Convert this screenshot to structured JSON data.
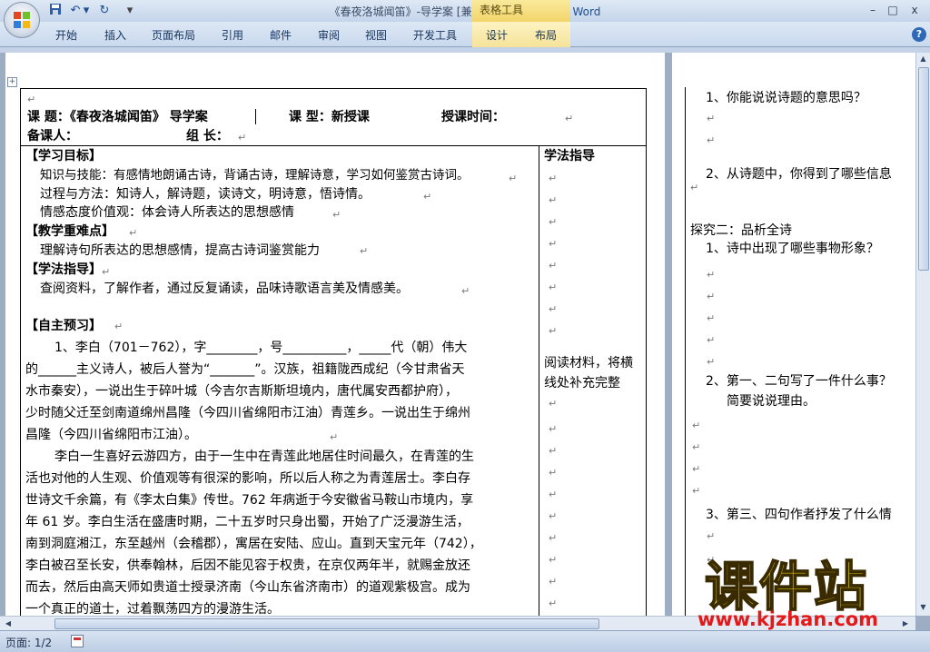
{
  "window": {
    "title_doc": "《春夜洛城闻笛》-导学案 [兼容模式] - ",
    "title_app": "Microsoft Word",
    "context_tool": "表格工具",
    "minimize": "–",
    "maximize": "□",
    "close": "x"
  },
  "quick_access": {
    "save": "save-icon",
    "undo": "↶",
    "undo_dropdown": "▾",
    "redo": "↻",
    "customize": "▾"
  },
  "ribbon": {
    "tabs": [
      "开始",
      "插入",
      "页面布局",
      "引用",
      "邮件",
      "审阅",
      "视图",
      "开发工具",
      "设计",
      "布局"
    ],
    "help": "?"
  },
  "document": {
    "para_mark": "↵",
    "header": {
      "course_title": "课  题：《春夜洛城闻笛》 导学案",
      "course_type": "课  型：新授课",
      "teach_time": "授课时间：",
      "prep_person": "备课人：",
      "group_leader": "组  长："
    },
    "main_lines": [
      {
        "text": "【学习目标】",
        "bold": true
      },
      {
        "text": "知识与技能：有感情地朗诵古诗，背诵古诗，理解诗意，学习如何鉴赏古诗词。",
        "bold": false
      },
      {
        "text": "过程与方法：知诗人，解诗题，读诗文，明诗意，悟诗情。",
        "bold": false
      },
      {
        "text": "情感态度价值观：体会诗人所表达的思想感情",
        "bold": false
      },
      {
        "text": "【教学重难点】",
        "bold": true
      },
      {
        "text": "理解诗句所表达的思想感情，提高古诗词鉴赏能力",
        "bold": false
      },
      {
        "text": "【学法指导】",
        "bold": true
      },
      {
        "text": "查阅资料，了解作者，通过反复诵读，品味诗歌语言美及情感美。",
        "bold": false
      },
      {
        "text": "",
        "bold": false
      },
      {
        "text": "【自主预习】",
        "bold": true
      },
      {
        "text": "1、李白（701－762），字________，号__________，_____代（朝）伟大",
        "bold": false
      },
      {
        "text": "的______主义诗人，被后人誉为“_______”。汉族，祖籍陇西成纪（今甘肃省天",
        "bold": false
      },
      {
        "text": "水市秦安），一说出生于碎叶城（今吉尔吉斯斯坦境内，唐代属安西都护府），",
        "bold": false
      },
      {
        "text": "少时随父迁至剑南道绵州昌隆（今四川省绵阳市江油）青莲乡。一说出生于绵州",
        "bold": false
      },
      {
        "text": "昌隆（今四川省绵阳市江油）。",
        "bold": false
      },
      {
        "text": "李白一生喜好云游四方，由于一生中在青莲此地居住时间最久，在青莲的生",
        "bold": false
      },
      {
        "text": "活也对他的人生观、价值观等有很深的影响，所以后人称之为青莲居士。李白存",
        "bold": false
      },
      {
        "text": "世诗文千余篇，有《李太白集》传世。762 年病逝于今安徽省马鞍山市境内，享",
        "bold": false
      },
      {
        "text": "年 61 岁。李白生活在盛唐时期，二十五岁时只身出蜀，开始了广泛漫游生活，",
        "bold": false
      },
      {
        "text": "南到洞庭湘江，东至越州（会稽郡），寓居在安陆、应山。直到天宝元年（742），",
        "bold": false
      },
      {
        "text": "李白被召至长安，供奉翰林，后因不能见容于权贵，在京仅两年半，就赐金放还",
        "bold": false
      },
      {
        "text": "而去，然后由高天师如贵道士授录济南（今山东省济南市）的道观紫极宫。成为",
        "bold": false
      },
      {
        "text": "一个真正的道士，过着飘荡四方的漫游生活。",
        "bold": false
      }
    ],
    "side_col": {
      "heading": "学法指导",
      "note_line1": "阅读材料，将横",
      "note_line2": "线处补充完整"
    },
    "right_page": {
      "q1": "1、你能说说诗题的意思吗？",
      "q2": "2、从诗题中，你得到了哪些信息",
      "section2": "探究二：品析全诗",
      "q3": "1、诗中出现了哪些事物形象？",
      "q4": "2、第一、二句写了一件什么事？",
      "q4b": "简要说说理由。",
      "q5": "3、第三、四句作者抒发了什么情"
    }
  },
  "status": {
    "page": "页面: 1/2"
  },
  "watermark": {
    "title": "课件站",
    "url": "www.kjzhan.com"
  }
}
